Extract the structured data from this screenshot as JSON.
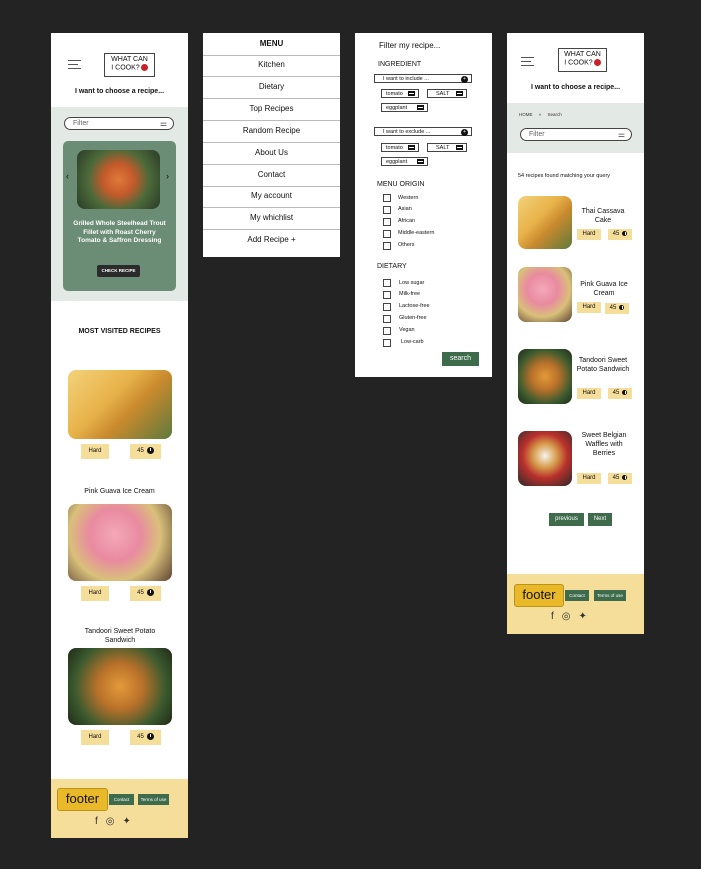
{
  "colors": {
    "background": "#232323",
    "accent_green": "#3d6b4c",
    "hero_green": "#6b8c75",
    "tag_yellow": "#f5dd9a",
    "breadcrumb_bg": "#e3e9e4"
  },
  "logo": {
    "line1": "WHAT CAN",
    "line2": "I COOK?"
  },
  "home": {
    "tagline": "I want to choose a recipe...",
    "filter_placeholder": "Filter",
    "hero_title": "Grilled Whole Steelhead Trout Fillet with Roast Cherry Tomato & Saffron Dressing",
    "hero_button": "CHECK RECIPE",
    "hero_prev": "‹",
    "hero_next": "›",
    "most_visited_title": "MOST VISITED RECIPES",
    "recipes": [
      {
        "title": "",
        "difficulty": "Hard",
        "time": "45"
      },
      {
        "title": "Pink Guava Ice Cream",
        "difficulty": "Hard",
        "time": "45"
      },
      {
        "title": "Tandoori Sweet Potato Sandwich",
        "difficulty": "Hard",
        "time": "45"
      }
    ]
  },
  "footer": {
    "brand": "footer",
    "contact": "Contact",
    "terms": "Terms of use",
    "social_icons": [
      "facebook-icon",
      "instagram-icon",
      "twitter-icon"
    ]
  },
  "menu": {
    "title": "MENU",
    "items": [
      "Kitchen",
      "Dietary",
      "Top Recipes",
      "Random Recipe",
      "About Us",
      "Contact",
      "My account",
      "My whichlist",
      "Add Recipe +"
    ]
  },
  "filter": {
    "title": "Filter my recipe...",
    "ingredient_heading": "INGREDIENT",
    "include_label": "I want to include ...",
    "include_chips": [
      "tomato",
      "SALT",
      "eggplant"
    ],
    "exclude_label": "I want to exclude ...",
    "exclude_chips": [
      "tomato",
      "SALT",
      "eggplant"
    ],
    "origin_heading": "MENU ORIGIN",
    "origins": [
      "Western",
      "Asian",
      "African",
      "Middle-eastern",
      "Others"
    ],
    "dietary_heading": "DIETARY",
    "dietary": [
      "Low sugar",
      "Milk-free",
      "Lactose-free",
      "Gluten-free",
      "Vegan",
      "Low-carb"
    ],
    "search_button": "search"
  },
  "results": {
    "tagline": "I want to choose a recipe...",
    "breadcrumb": [
      "HOME",
      "Search"
    ],
    "breadcrumb_sep": "»",
    "filter_placeholder": "Filter",
    "count_text": "54 recipes found matching your query",
    "items": [
      {
        "title": "Thai Cassava Cake",
        "difficulty": "Hard",
        "time": "45"
      },
      {
        "title": "Pink Guava Ice Cream",
        "difficulty": "Hard",
        "time": "45"
      },
      {
        "title": "Tandoori Sweet Potato Sandwich",
        "difficulty": "Hard",
        "time": "45"
      },
      {
        "title": "Sweet Belgian Waffles with Berries",
        "difficulty": "Hard",
        "time": "45"
      }
    ],
    "prev_button": "previous",
    "next_button": "Next"
  }
}
